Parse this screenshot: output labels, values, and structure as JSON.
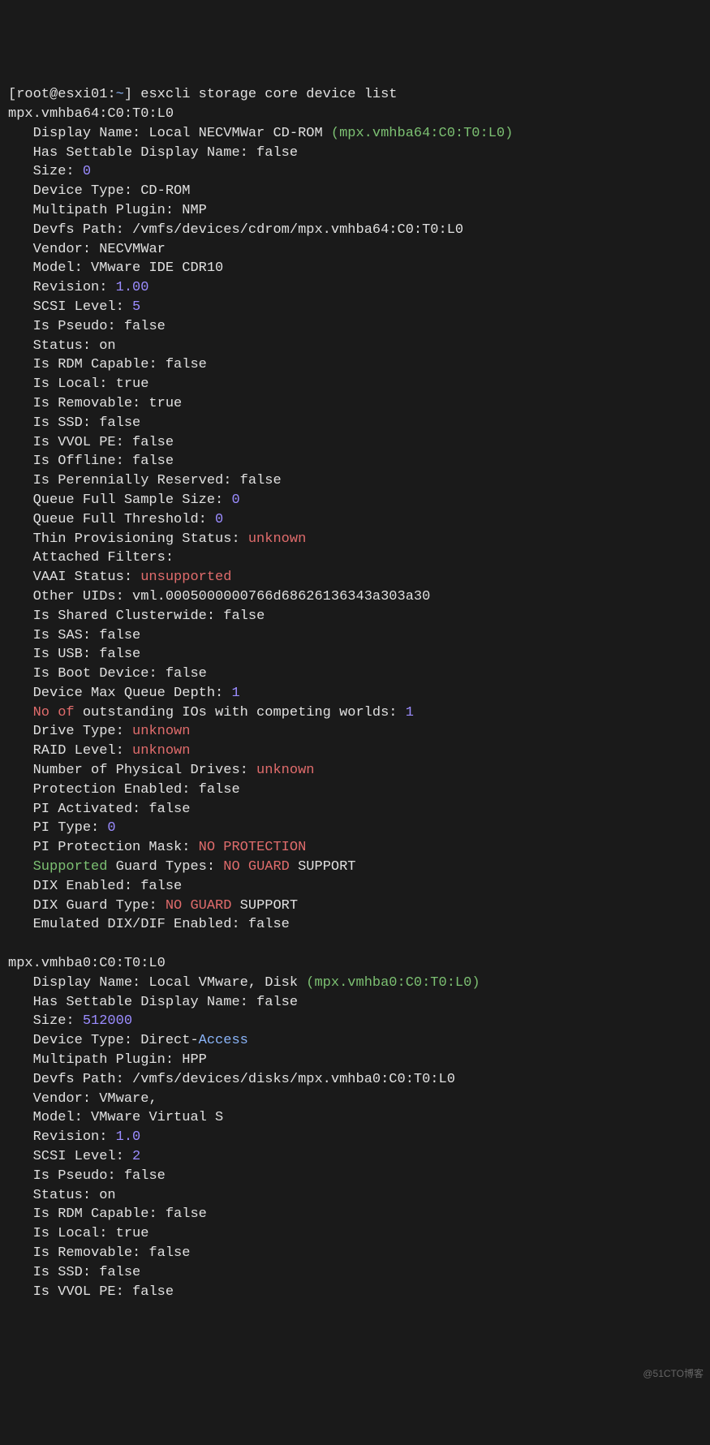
{
  "prompt": {
    "open": "[",
    "user": "root",
    "at": "@",
    "host": "esxi01",
    "colon": ":",
    "path": "~",
    "close": "]",
    "command": " esxcli storage core device list"
  },
  "d1": {
    "id": "mpx.vmhba64:C0:T0:L0",
    "display_name_k": "Display Name",
    "display_name_v1": " Local NECVMWar CD-ROM ",
    "display_name_v2": "(mpx.vmhba64:C0:T0:L0)",
    "has_settable_k": "Has Settable Display Name",
    "has_settable_v": " false",
    "size_k": "Size",
    "size_v": " 0",
    "device_type_k": "Device Type",
    "device_type_v": " CD-ROM",
    "multipath_k": "Multipath Plugin",
    "multipath_v": " NMP",
    "devfs_k": "Devfs Path",
    "devfs_v": " /vmfs/devices/cdrom/mpx.vmhba64:C0:T0:L0",
    "vendor_k": "Vendor",
    "vendor_v": " NECVMWar",
    "model_k": "Model",
    "model_v": " VMware IDE CDR10",
    "revision_k": "Revision",
    "revision_v": " 1.00",
    "scsi_k": "SCSI Level",
    "scsi_v": " 5",
    "pseudo_k": "Is Pseudo",
    "pseudo_v": " false",
    "status_k": "Status",
    "status_v": " on",
    "rdm_k": "Is RDM Capable",
    "rdm_v": " false",
    "local_k": "Is Local",
    "local_v": " true",
    "removable_k": "Is Removable",
    "removable_v": " true",
    "ssd_k": "Is SSD",
    "ssd_v": " false",
    "vvol_k": "Is VVOL PE",
    "vvol_v": " false",
    "offline_k": "Is Offline",
    "offline_v": " false",
    "perenn_k": "Is Perennially Reserved",
    "perenn_v": " false",
    "qfss_k": "Queue Full Sample Size",
    "qfss_v": " 0",
    "qft_k": "Queue Full Threshold",
    "qft_v": " 0",
    "thin_k": "Thin Provisioning Status",
    "thin_v": " unknown",
    "af_k": "Attached Filters",
    "af_v": "",
    "vaai_k": "VAAI Status",
    "vaai_v": " unsupported",
    "uids_k": "Other UIDs",
    "uids_v": " vml.0005000000766d68626136343a303a30",
    "shared_k": "Is Shared Clusterwide",
    "shared_v": " false",
    "sas_k": "Is SAS",
    "sas_v": " false",
    "usb_k": "Is USB",
    "usb_v": " false",
    "boot_k": "Is Boot Device",
    "boot_v": " false",
    "mqd_k": "Device Max Queue Depth",
    "mqd_v": " 1",
    "noof1": "No",
    "noof2": " of",
    "noof3": " outstanding IOs with competing worlds",
    "noof_v": " 1",
    "drive_k": "Drive Type",
    "drive_v": " unknown",
    "raid_k": "RAID Level",
    "raid_v": " unknown",
    "phys_k": "Number of Physical Drives",
    "phys_v": " unknown",
    "prot_k": "Protection Enabled",
    "prot_v": " false",
    "pia_k": "PI Activated",
    "pia_v": " false",
    "pit_k": "PI Type",
    "pit_v": " 0",
    "pip_k": "PI Protection Mask",
    "pip_v": " NO PROTECTION",
    "sgt1": "Supported",
    "sgt2": " Guard Types",
    "sgt_v1": " NO GUARD",
    "sgt_v2": " SUPPORT",
    "dix_k": "DIX Enabled",
    "dix_v": " false",
    "dixg_k": "DIX Guard Type",
    "dixg_v1": " NO GUARD",
    "dixg_v2": " SUPPORT",
    "emdix_k": "Emulated DIX/DIF Enabled",
    "emdix_v": " false"
  },
  "d2": {
    "id": "mpx.vmhba0:C0:T0:L0",
    "display_name_k": "Display Name",
    "display_name_v1": " Local VMware, Disk ",
    "display_name_v2": "(mpx.vmhba0:C0:T0:L0)",
    "has_settable_k": "Has Settable Display Name",
    "has_settable_v": " false",
    "size_k": "Size",
    "size_v": " 512000",
    "device_type_k": "Device Type",
    "device_type_v1": " Direct-",
    "device_type_v2": "Access",
    "multipath_k": "Multipath Plugin",
    "multipath_v": " HPP",
    "devfs_k": "Devfs Path",
    "devfs_v": " /vmfs/devices/disks/mpx.vmhba0:C0:T0:L0",
    "vendor_k": "Vendor",
    "vendor_v": " VMware,",
    "model_k": "Model",
    "model_v": " VMware Virtual S",
    "revision_k": "Revision",
    "revision_v": " 1.0",
    "scsi_k": "SCSI Level",
    "scsi_v": " 2",
    "pseudo_k": "Is Pseudo",
    "pseudo_v": " false",
    "status_k": "Status",
    "status_v": " on",
    "rdm_k": "Is RDM Capable",
    "rdm_v": " false",
    "local_k": "Is Local",
    "local_v": " true",
    "removable_k": "Is Removable",
    "removable_v": " false",
    "ssd_k": "Is SSD",
    "ssd_v": " false",
    "vvol_k": "Is VVOL PE",
    "vvol_v": " false"
  },
  "watermark": "@51CTO博客"
}
